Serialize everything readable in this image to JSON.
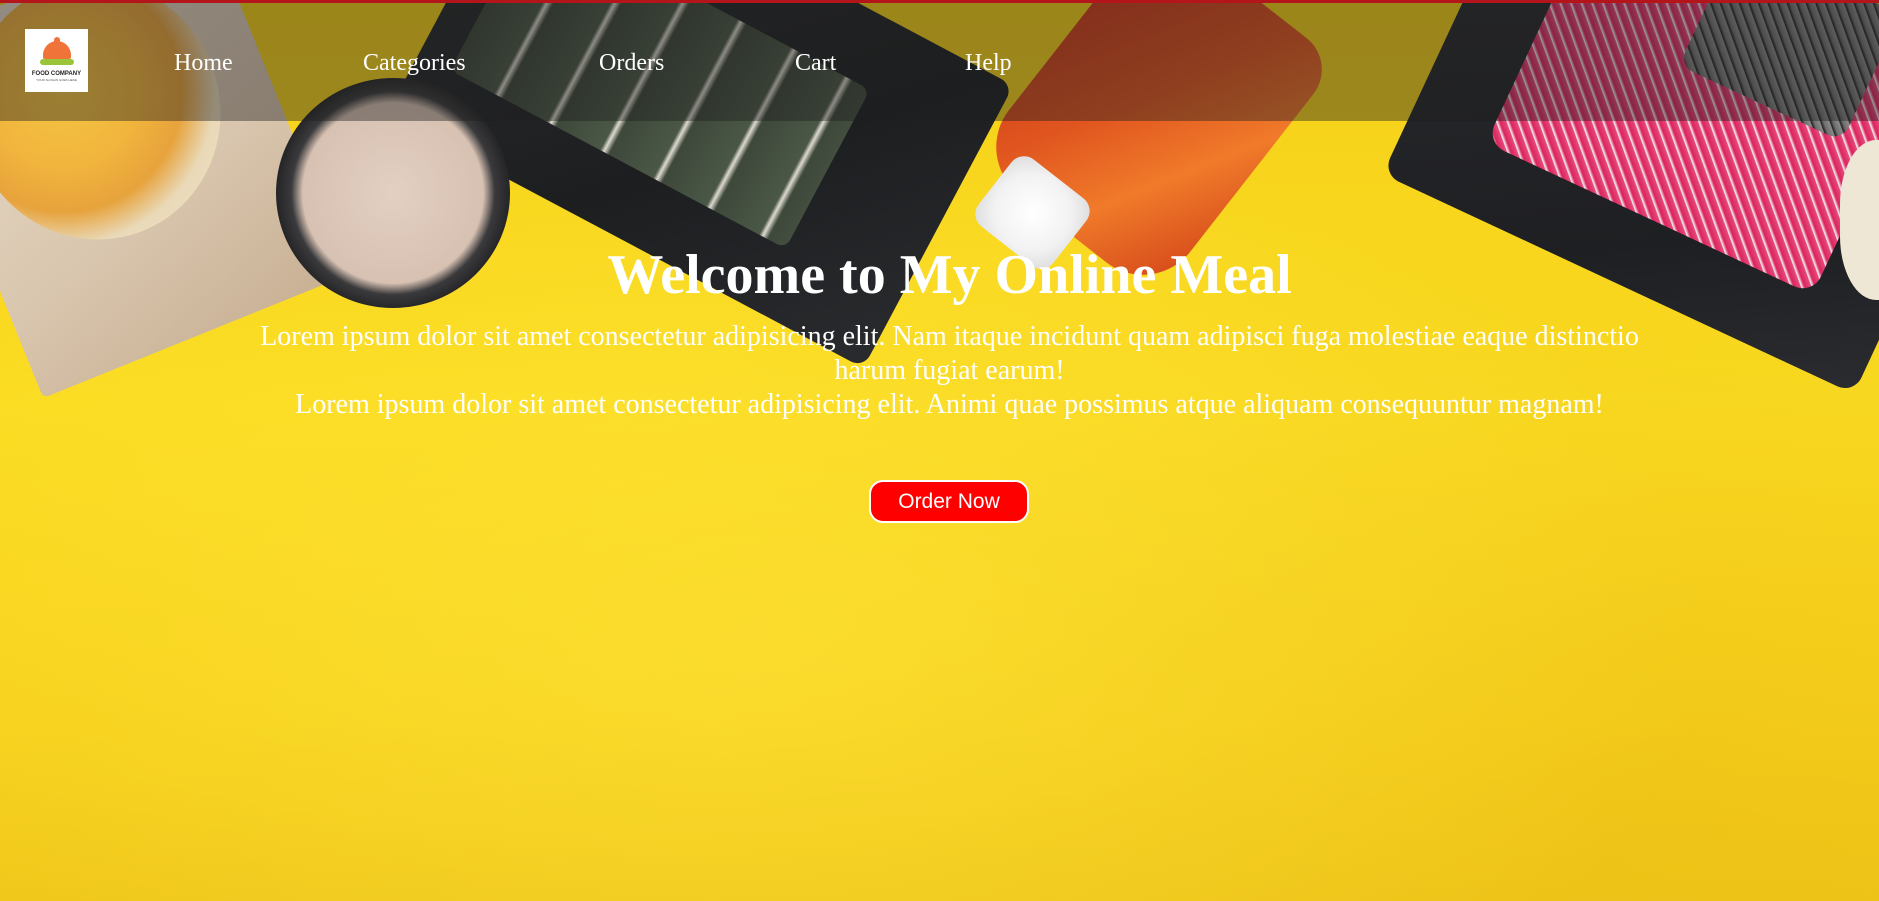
{
  "brand": {
    "logo_text": "FOOD COMPANY",
    "logo_subtext": "YOUR SLOGAN GOES HERE"
  },
  "nav": {
    "items": [
      {
        "label": "Home"
      },
      {
        "label": "Categories"
      },
      {
        "label": "Orders"
      },
      {
        "label": "Cart"
      },
      {
        "label": "Help"
      }
    ]
  },
  "hero": {
    "title": "Welcome to My Online Meal",
    "paragraph_1": "Lorem ipsum dolor sit amet consectetur adipisicing elit. Nam itaque incidunt quam adipisci fuga molestiae eaque distinctio harum fugiat earum!",
    "paragraph_2": "Lorem ipsum dolor sit amet consectetur adipisicing elit. Animi quae possimus atque aliquam consequuntur magnam!",
    "cta_label": "Order Now"
  },
  "colors": {
    "background_accent": "#f8d21c",
    "cta_background": "#ff0000",
    "top_border": "#b3151b",
    "text": "#ffffff"
  },
  "icons": {
    "logo": "food-delivery-cloche-icon"
  }
}
